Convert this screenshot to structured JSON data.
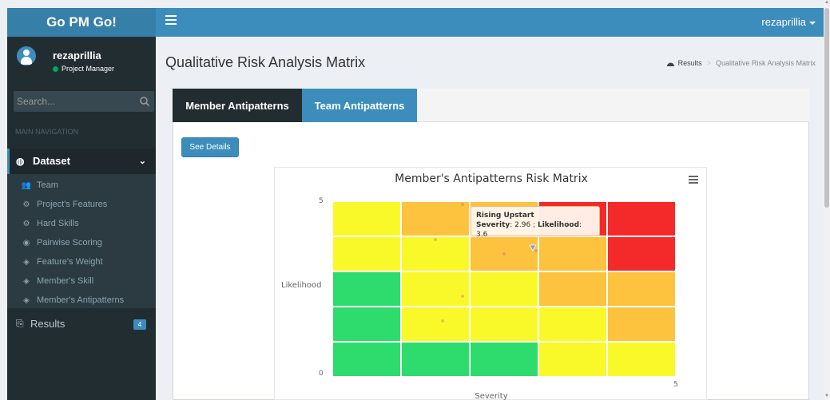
{
  "app": {
    "logo": "Go PM Go!"
  },
  "header": {
    "user": "rezaprillia"
  },
  "sidebar": {
    "user": {
      "name": "rezaprillia",
      "role": "Project Manager"
    },
    "search": {
      "placeholder": "Search..."
    },
    "nav_header": "MAIN NAVIGATION",
    "dataset": {
      "label": "Dataset"
    },
    "items": [
      {
        "label": "Team",
        "icon": "users-icon"
      },
      {
        "label": "Project's Features",
        "icon": "gear-icon"
      },
      {
        "label": "Hard Skills",
        "icon": "gear-icon"
      },
      {
        "label": "Pairwise Scoring",
        "icon": "target-icon"
      },
      {
        "label": "Feature's Weight",
        "icon": "cube-icon"
      },
      {
        "label": "Member's Skill",
        "icon": "cube-icon"
      },
      {
        "label": "Member's Antipatterns",
        "icon": "cube-icon"
      }
    ],
    "results": {
      "label": "Results",
      "badge": "4"
    }
  },
  "page": {
    "title": "Qualitative Risk Analysis Matrix",
    "breadcrumb": {
      "home": "Results",
      "current": "Qualitative Risk Analysis Matrix"
    }
  },
  "tabs": {
    "member": "Member Antipatterns",
    "team": "Team Antipatterns"
  },
  "details_button": "See Details",
  "colors": {
    "green": "#2edc6e",
    "yellow": "#f9f92a",
    "amber": "#fdc23e",
    "red": "#f42a2a",
    "brand": "#3c8dbc"
  },
  "chart_data": {
    "type": "heatmap",
    "title": "Member's Antipatterns Risk Matrix",
    "xlabel": "Severity",
    "ylabel": "Likelihood",
    "xlim": [
      0,
      5
    ],
    "ylim": [
      0,
      5
    ],
    "x_tick_labels": [
      "5"
    ],
    "y_tick_labels": [
      "5",
      "0"
    ],
    "grid_rows": [
      [
        "yellow",
        "amber",
        "amber",
        "red",
        "red"
      ],
      [
        "yellow",
        "yellow",
        "amber",
        "amber",
        "red"
      ],
      [
        "green",
        "yellow",
        "yellow",
        "amber",
        "amber"
      ],
      [
        "green",
        "yellow",
        "yellow",
        "yellow",
        "amber"
      ],
      [
        "green",
        "green",
        "green",
        "yellow",
        "yellow"
      ]
    ],
    "points": [
      {
        "name": "Rising Upstart",
        "x": 2.96,
        "y": 3.6
      },
      {
        "x": 1.9,
        "y": 4.9
      },
      {
        "x": 1.5,
        "y": 3.9
      },
      {
        "x": 2.5,
        "y": 3.5
      },
      {
        "x": 1.9,
        "y": 2.3
      },
      {
        "x": 1.6,
        "y": 1.6
      }
    ],
    "tooltip": {
      "title": "Rising Upstart",
      "severity_label": "Severity",
      "severity": "2.96",
      "likelihood_label": "Likelihood",
      "likelihood": "3.6"
    }
  }
}
